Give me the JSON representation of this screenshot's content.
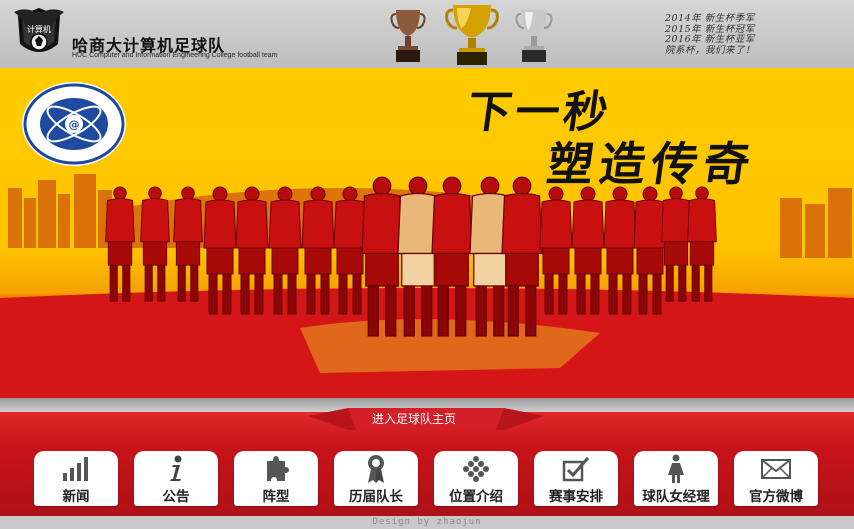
{
  "header": {
    "team_name": "哈商大计算机足球队",
    "team_subtitle": "HUC Computer and Information Engineering College football team",
    "badge_text": "计算机",
    "news": [
      "2014年 新生杯季军",
      "2015年 新生杯冠军",
      "2016年 新生杯亚军",
      "院系杯，我们来了！"
    ]
  },
  "banner": {
    "slogan_line1": "下一秒",
    "slogan_line2": "塑造传奇"
  },
  "nav": {
    "enter_label": "进入足球队主页",
    "buttons": [
      {
        "label": "新闻",
        "icon": "bar-chart-icon"
      },
      {
        "label": "公告",
        "icon": "info-icon"
      },
      {
        "label": "阵型",
        "icon": "puzzle-icon"
      },
      {
        "label": "历届队长",
        "icon": "award-ribbon-icon"
      },
      {
        "label": "位置介绍",
        "icon": "grid-dots-icon"
      },
      {
        "label": "赛事安排",
        "icon": "checkbox-icon"
      },
      {
        "label": "球队女经理",
        "icon": "woman-icon"
      },
      {
        "label": "官方微博",
        "icon": "mail-icon"
      }
    ]
  },
  "footer": {
    "credit": "Design by zhaojun"
  },
  "colors": {
    "banner_yellow": "#ffc300",
    "banner_red": "#e01010",
    "nav_red": "#c8141a"
  }
}
